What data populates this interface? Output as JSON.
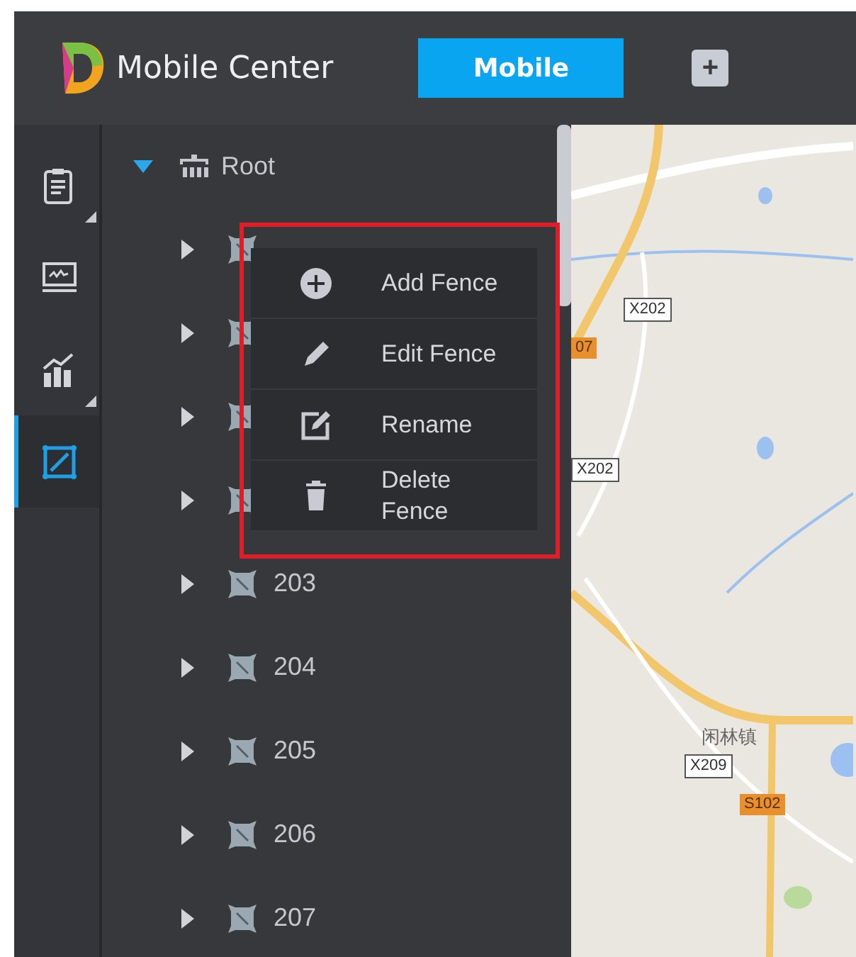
{
  "header": {
    "title": "Mobile Center",
    "mode_button": "Mobile",
    "add_button": "+"
  },
  "sidebar": {
    "items": [
      {
        "kind": "report",
        "selected": false,
        "corner": true
      },
      {
        "kind": "monitor",
        "selected": false
      },
      {
        "kind": "chart",
        "selected": false,
        "corner": true
      },
      {
        "kind": "fence",
        "selected": true
      }
    ]
  },
  "tree": {
    "label": "Root",
    "expanded": true,
    "children": [
      {
        "expanded": false
      },
      {
        "expanded": false
      },
      {
        "expanded": false
      },
      {
        "expanded": false
      },
      {
        "label": "203",
        "expanded": false
      },
      {
        "label": "204",
        "expanded": false
      },
      {
        "label": "205",
        "expanded": false
      },
      {
        "label": "206",
        "expanded": false
      },
      {
        "label": "207",
        "expanded": false
      }
    ]
  },
  "context_menu": {
    "items": [
      {
        "kind": "add",
        "label": "Add Fence"
      },
      {
        "kind": "edit",
        "label": "Edit Fence"
      },
      {
        "kind": "rename",
        "label": "Rename"
      },
      {
        "kind": "delete",
        "label": "Delete Fence"
      }
    ]
  },
  "map": {
    "labels": [
      {
        "kind": "county-road",
        "text": "X202"
      },
      {
        "kind": "highway",
        "text": "07"
      },
      {
        "kind": "county-road",
        "text": "X202"
      },
      {
        "kind": "place",
        "text": "闲林镇"
      },
      {
        "kind": "county-road",
        "text": "X209"
      },
      {
        "kind": "highway",
        "text": "S102"
      }
    ]
  }
}
